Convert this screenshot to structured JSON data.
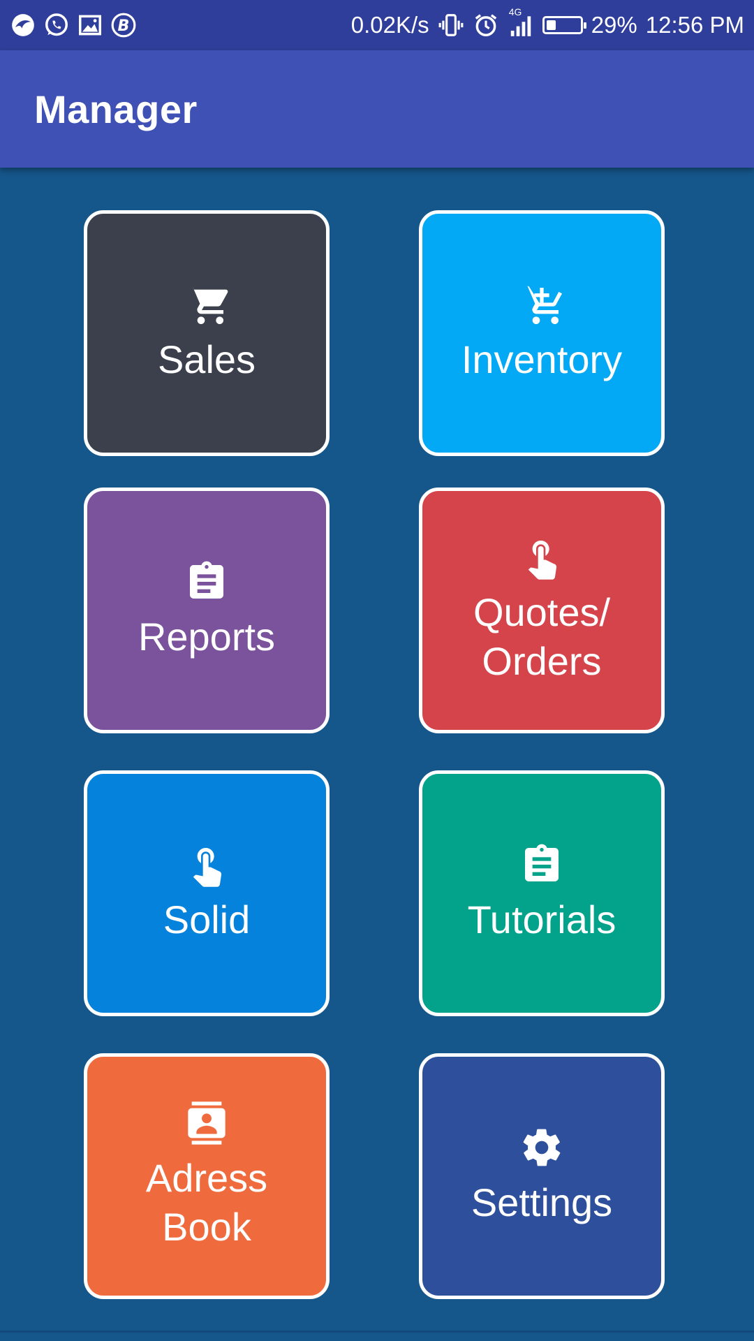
{
  "status_bar": {
    "net_speed": "0.02K/s",
    "network_type": "4G",
    "battery_percent_text": "29%",
    "battery_level": 0.29,
    "time": "12:56 PM",
    "left_icons": [
      "bird-app-icon",
      "whatsapp-icon",
      "image-notification-icon",
      "b-app-icon"
    ],
    "right_icons": [
      "vibrate-icon",
      "alarm-icon",
      "signal-icon",
      "battery-icon"
    ]
  },
  "app_bar": {
    "title": "Manager",
    "color": "#3f51b5"
  },
  "tiles": [
    {
      "label": "Sales",
      "icon": "shopping-cart-icon",
      "color": "#3b404c"
    },
    {
      "label": "Inventory",
      "icon": "add-to-cart-icon",
      "color": "#03a9f4"
    },
    {
      "label": "Reports",
      "icon": "clipboard-icon",
      "color": "#7b529c"
    },
    {
      "label": "Quotes/\nOrders",
      "icon": "touch-hand-icon",
      "color": "#d6444b"
    },
    {
      "label": "Solid",
      "icon": "touch-hand-icon",
      "color": "#0582db"
    },
    {
      "label": "Tutorials",
      "icon": "clipboard-icon",
      "color": "#02a38a"
    },
    {
      "label": "Adress\nBook",
      "icon": "contact-card-icon",
      "color": "#ef6b3e"
    },
    {
      "label": "Settings",
      "icon": "gear-icon",
      "color": "#2e4f9b"
    }
  ],
  "colors": {
    "background": "#15568b",
    "status_bar": "#2f3e9a",
    "tile_border": "#ffffff"
  }
}
